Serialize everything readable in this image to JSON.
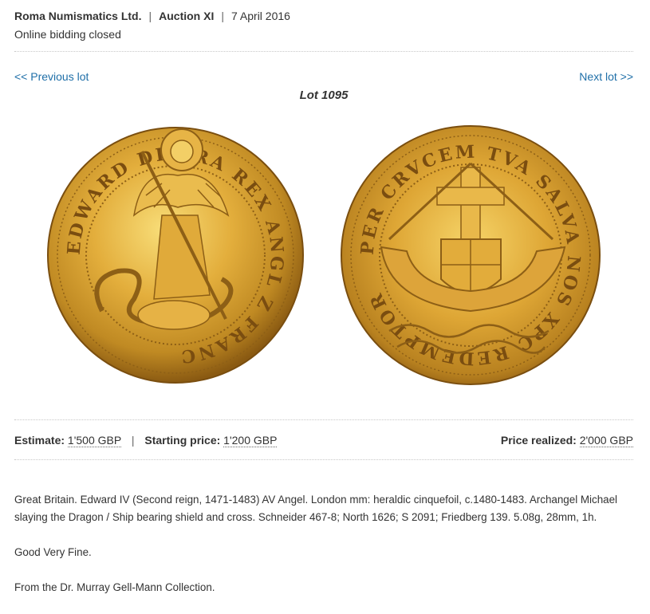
{
  "header": {
    "company": "Roma Numismatics Ltd.",
    "separator": "|",
    "auction": "Auction XI",
    "date": "7 April 2016",
    "status": "Online bidding closed"
  },
  "nav": {
    "previous": "<< Previous lot",
    "next": "Next lot >>"
  },
  "lot": {
    "title": "Lot 1095"
  },
  "coin": {
    "obverse_legend": "EDWARD DI GRA REX ANGL Z FRANC",
    "reverse_legend": "PER CRVCEM TVA SALVA NOS XPC REDEMPTOR",
    "colors": {
      "gold_light": "#f6d060",
      "gold": "#d9a22f",
      "gold_dark": "#8a5a12"
    }
  },
  "prices": {
    "estimate_label": "Estimate:",
    "estimate_value": "1'500 GBP",
    "separator": "|",
    "starting_label": "Starting price:",
    "starting_value": "1'200 GBP",
    "realized_label": "Price realized:",
    "realized_value": "2'000 GBP"
  },
  "description": {
    "main": "Great Britain. Edward IV (Second reign, 1471-1483) AV Angel. London mm: heraldic cinquefoil, c.1480-1483. Archangel Michael slaying the Dragon / Ship bearing shield and cross. Schneider 467-8; North 1626; S 2091; Friedberg 139. 5.08g, 28mm, 1h.",
    "grade": "Good Very Fine.",
    "provenance": "From the Dr. Murray Gell-Mann Collection."
  }
}
